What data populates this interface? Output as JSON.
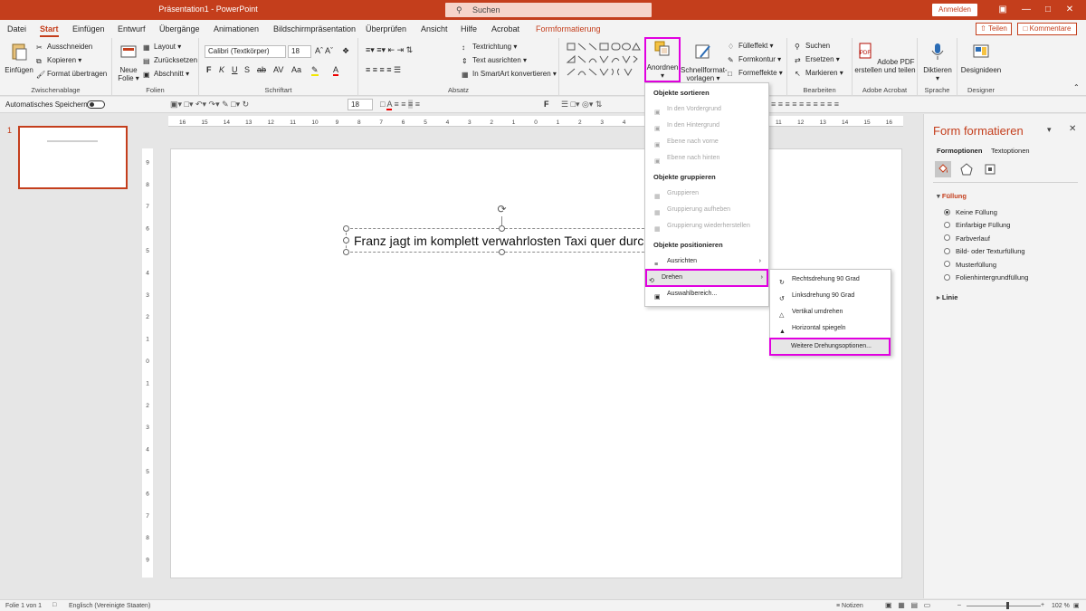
{
  "app": {
    "window_title": "Präsentation1  -  PowerPoint",
    "search_label": "Suchen",
    "signin_label": "Anmelden"
  },
  "tabs": [
    "Datei",
    "Start",
    "Einfügen",
    "Entwurf",
    "Übergänge",
    "Animationen",
    "Bildschirmpräsentation",
    "Überprüfen",
    "Ansicht",
    "Hilfe",
    "Acrobat",
    "Formformatierung"
  ],
  "active_tab": "Start",
  "share_label": "Teilen",
  "comments_label": "Kommentare",
  "ribbon": {
    "clipboard": {
      "paste": "Einfügen",
      "cut": "Ausschneiden",
      "copy": "Kopieren",
      "format_painter": "Format übertragen",
      "group": "Zwischenablage"
    },
    "slides": {
      "new_slide_line1": "Neue",
      "new_slide_line2": "Folie",
      "layout": "Layout",
      "reset": "Zurücksetzen",
      "section": "Abschnitt",
      "group": "Folien"
    },
    "font": {
      "font_name": "Calibri (Textkörper)",
      "font_size": "18",
      "bold": "F",
      "italic": "K",
      "underline": "U",
      "shadow": "S",
      "group": "Schriftart"
    },
    "paragraph": {
      "text_direction": "Textrichtung",
      "align_text": "Text ausrichten",
      "smartart": "In SmartArt konvertieren",
      "group": "Absatz"
    },
    "drawing": {
      "arrange": "Anordnen",
      "quick_styles_line1": "Schnellformat-",
      "quick_styles_line2": "vorlagen",
      "fill": "Fülleffekt",
      "outline": "Formkontur",
      "effects": "Formeffekte",
      "group": "Zeichnung"
    },
    "editing": {
      "find": "Suchen",
      "replace": "Ersetzen",
      "select": "Markieren",
      "group": "Bearbeiten"
    },
    "acrobat": {
      "line1": "Adobe PDF",
      "line2": "erstellen und teilen",
      "group": "Adobe Acrobat"
    },
    "voice": {
      "dictate": "Diktieren",
      "group": "Sprache"
    },
    "designer": {
      "ideas": "Designideen",
      "group": "Designer"
    }
  },
  "qat": {
    "autosave": "Automatisches Speichern",
    "font_size": "18",
    "bold": "F"
  },
  "thumbnail": {
    "number": "1"
  },
  "slide": {
    "text": "Franz jagt im komplett verwahrlosten Taxi quer durch"
  },
  "arrange_menu": {
    "sort_header": "Objekte sortieren",
    "bring_front": "In den Vordergrund",
    "send_back": "In den Hintergrund",
    "bring_forward": "Ebene nach vorne",
    "send_backward": "Ebene nach hinten",
    "group_header": "Objekte gruppieren",
    "group": "Gruppieren",
    "ungroup": "Gruppierung aufheben",
    "regroup": "Gruppierung wiederherstellen",
    "position_header": "Objekte positionieren",
    "align": "Ausrichten",
    "rotate": "Drehen",
    "selection_pane": "Auswahlbereich..."
  },
  "rotate_menu": {
    "right90": "Rechtsdrehung 90 Grad",
    "left90": "Linksdrehung 90 Grad",
    "flip_v": "Vertikal umdrehen",
    "flip_h": "Horizontal spiegeln",
    "more": "Weitere Drehungsoptionen..."
  },
  "format_pane": {
    "title": "Form formatieren",
    "tab_shape": "Formoptionen",
    "tab_text": "Textoptionen",
    "fill_section": "Füllung",
    "fill_options": [
      "Keine Füllung",
      "Einfarbige Füllung",
      "Farbverlauf",
      "Bild- oder Texturfüllung",
      "Musterfüllung",
      "Folienhintergrundfüllung"
    ],
    "selected_fill": "Keine Füllung",
    "line_section": "Linie"
  },
  "status": {
    "slide_count": "Folie 1 von 1",
    "language": "Englisch (Vereinigte Staaten)",
    "notes": "Notizen",
    "zoom": "102 %"
  },
  "colors": {
    "accent": "#c43e1c",
    "highlight": "#e100e0"
  }
}
